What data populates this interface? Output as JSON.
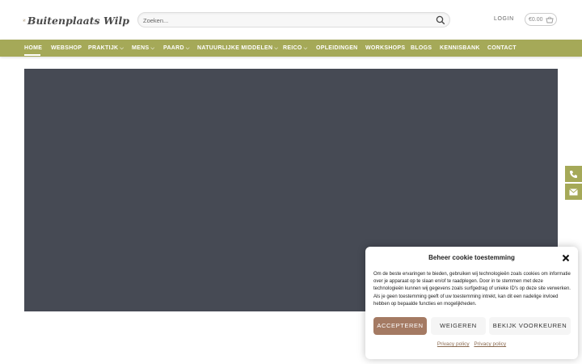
{
  "brand": {
    "name": "Buitenplaats Wilp"
  },
  "search": {
    "placeholder": "Zoeken..."
  },
  "header": {
    "login_label": "LOGIN",
    "cart_price": "€0.00"
  },
  "nav": {
    "items": [
      {
        "label": "HOME",
        "has_dropdown": false,
        "active": true
      },
      {
        "label": "WEBSHOP",
        "has_dropdown": false
      },
      {
        "label": "PRAKTIJK",
        "has_dropdown": true
      },
      {
        "label": "MENS",
        "has_dropdown": true
      },
      {
        "label": "PAARD",
        "has_dropdown": true
      },
      {
        "label": "NATUURLIJKE MIDDELEN",
        "has_dropdown": true
      },
      {
        "label": "REICO",
        "has_dropdown": true
      },
      {
        "label": "OPLEIDINGEN",
        "has_dropdown": false
      },
      {
        "label": "WORKSHOPS",
        "has_dropdown": false
      },
      {
        "label": "BLOGS",
        "has_dropdown": false
      },
      {
        "label": "KENNISBANK",
        "has_dropdown": false
      },
      {
        "label": "CONTACT",
        "has_dropdown": false
      }
    ]
  },
  "side_buttons": [
    {
      "icon": "phone-icon"
    },
    {
      "icon": "envelope-icon"
    }
  ],
  "cookie": {
    "title": "Beheer cookie toestemming",
    "body": "Om de beste ervaringen te bieden, gebruiken wij technologieën zoals cookies om informatie over je apparaat op te slaan en/of te raadplegen. Door in te stemmen met deze technologieën kunnen wij gegevens zoals surfgedrag of unieke ID's op deze site verwerken. Als je geen toestemming geeft of uw toestemming intrekt, kan dit een nadelige invloed hebben op bepaalde functies en mogelijkheden.",
    "accept_label": "ACCEPTEREN",
    "deny_label": "WEIGEREN",
    "preferences_label": "BEKIJK VOORKEUREN",
    "link_1": "Privacy policy",
    "link_2": "Privacy policy"
  },
  "colors": {
    "nav": "#a5a958",
    "hero": "#464a54",
    "accept": "#a47a63"
  }
}
